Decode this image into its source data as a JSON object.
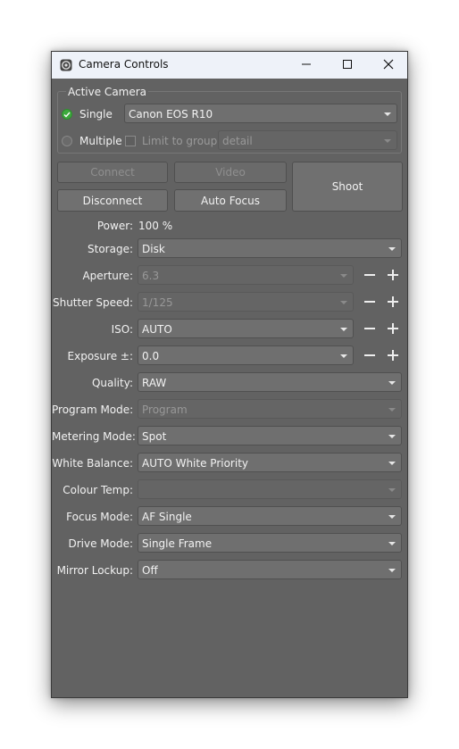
{
  "window": {
    "title": "Camera Controls"
  },
  "active_camera": {
    "group_title": "Active Camera",
    "single_label": "Single",
    "single_value": "Canon EOS R10",
    "multiple_label": "Multiple",
    "limit_label": "Limit to group:",
    "limit_value": "detail"
  },
  "buttons": {
    "connect": "Connect",
    "video": "Video",
    "shoot": "Shoot",
    "disconnect": "Disconnect",
    "auto_focus": "Auto Focus"
  },
  "power": {
    "label": "Power:",
    "value": "100 %"
  },
  "settings": [
    {
      "label": "Storage:",
      "value": "Disk",
      "enabled": true,
      "stepper": false
    },
    {
      "label": "Aperture:",
      "value": "6.3",
      "enabled": false,
      "stepper": true
    },
    {
      "label": "Shutter Speed:",
      "value": "1/125",
      "enabled": false,
      "stepper": true
    },
    {
      "label": "ISO:",
      "value": "AUTO",
      "enabled": true,
      "stepper": true
    },
    {
      "label": "Exposure ±:",
      "value": "0.0",
      "enabled": true,
      "stepper": true
    },
    {
      "label": "Quality:",
      "value": "RAW",
      "enabled": true,
      "stepper": false
    },
    {
      "label": "Program Mode:",
      "value": "Program",
      "enabled": false,
      "stepper": false
    },
    {
      "label": "Metering Mode:",
      "value": "Spot",
      "enabled": true,
      "stepper": false
    },
    {
      "label": "White Balance:",
      "value": "AUTO White Priority",
      "enabled": true,
      "stepper": false
    },
    {
      "label": "Colour Temp:",
      "value": "",
      "enabled": false,
      "stepper": false
    },
    {
      "label": "Focus Mode:",
      "value": "AF Single",
      "enabled": true,
      "stepper": false
    },
    {
      "label": "Drive Mode:",
      "value": "Single Frame",
      "enabled": true,
      "stepper": false
    },
    {
      "label": "Mirror Lockup:",
      "value": "Off",
      "enabled": true,
      "stepper": false
    }
  ],
  "colors": {
    "panel_bg": "#626262",
    "radio_on": "#3daa3d",
    "titlebar_bg": "#eef2f9"
  },
  "icons": {
    "app": "camera-app-icon",
    "minimize": "minimize-icon",
    "maximize": "maximize-icon",
    "close": "close-icon",
    "dropdown": "chevron-down-icon",
    "decrement": "minus-icon",
    "increment": "plus-icon"
  }
}
